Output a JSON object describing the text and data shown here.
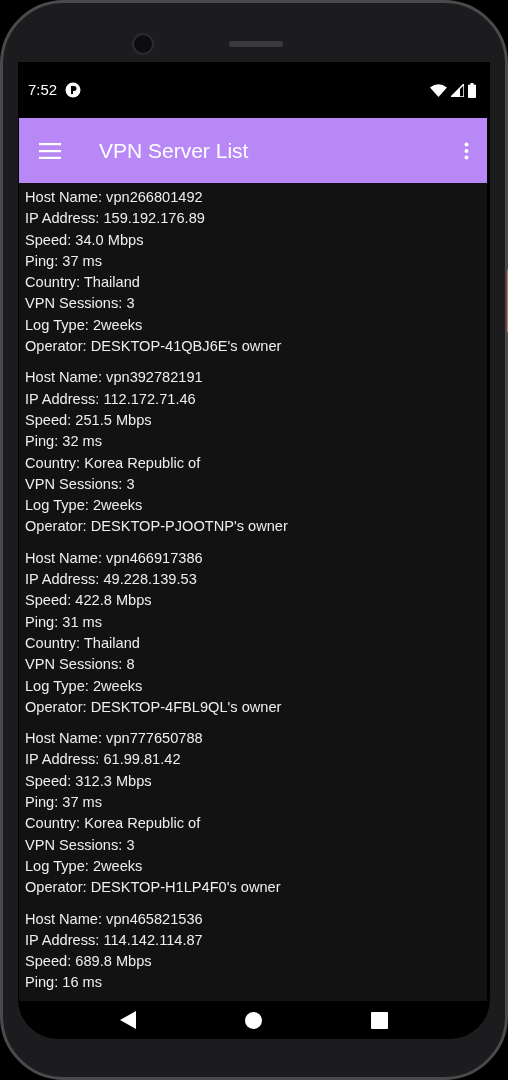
{
  "status_bar": {
    "time": "7:52"
  },
  "app_bar": {
    "title": "VPN Server List"
  },
  "servers": [
    {
      "lines": [
        "Host Name: vpn266801492",
        "IP Address: 159.192.176.89",
        "Speed: 34.0 Mbps",
        "Ping: 37 ms",
        "Country: Thailand",
        "VPN Sessions: 3",
        "Log Type: 2weeks",
        "Operator: DESKTOP-41QBJ6E's owner"
      ]
    },
    {
      "lines": [
        "Host Name: vpn392782191",
        "IP Address: 112.172.71.46",
        "Speed: 251.5 Mbps",
        "Ping: 32 ms",
        "Country: Korea Republic of",
        "VPN Sessions: 3",
        "Log Type: 2weeks",
        "Operator: DESKTOP-PJOOTNP's owner"
      ]
    },
    {
      "lines": [
        "Host Name: vpn466917386",
        "IP Address: 49.228.139.53",
        "Speed: 422.8 Mbps",
        "Ping: 31 ms",
        "Country: Thailand",
        "VPN Sessions: 8",
        "Log Type: 2weeks",
        "Operator: DESKTOP-4FBL9QL's owner"
      ]
    },
    {
      "lines": [
        "Host Name: vpn777650788",
        "IP Address: 61.99.81.42",
        "Speed: 312.3 Mbps",
        "Ping: 37 ms",
        "Country: Korea Republic of",
        "VPN Sessions: 3",
        "Log Type: 2weeks",
        "Operator: DESKTOP-H1LP4F0's owner"
      ]
    },
    {
      "lines": [
        "Host Name: vpn465821536",
        "IP Address: 114.142.114.87",
        "Speed: 689.8 Mbps",
        "Ping: 16 ms"
      ]
    }
  ]
}
